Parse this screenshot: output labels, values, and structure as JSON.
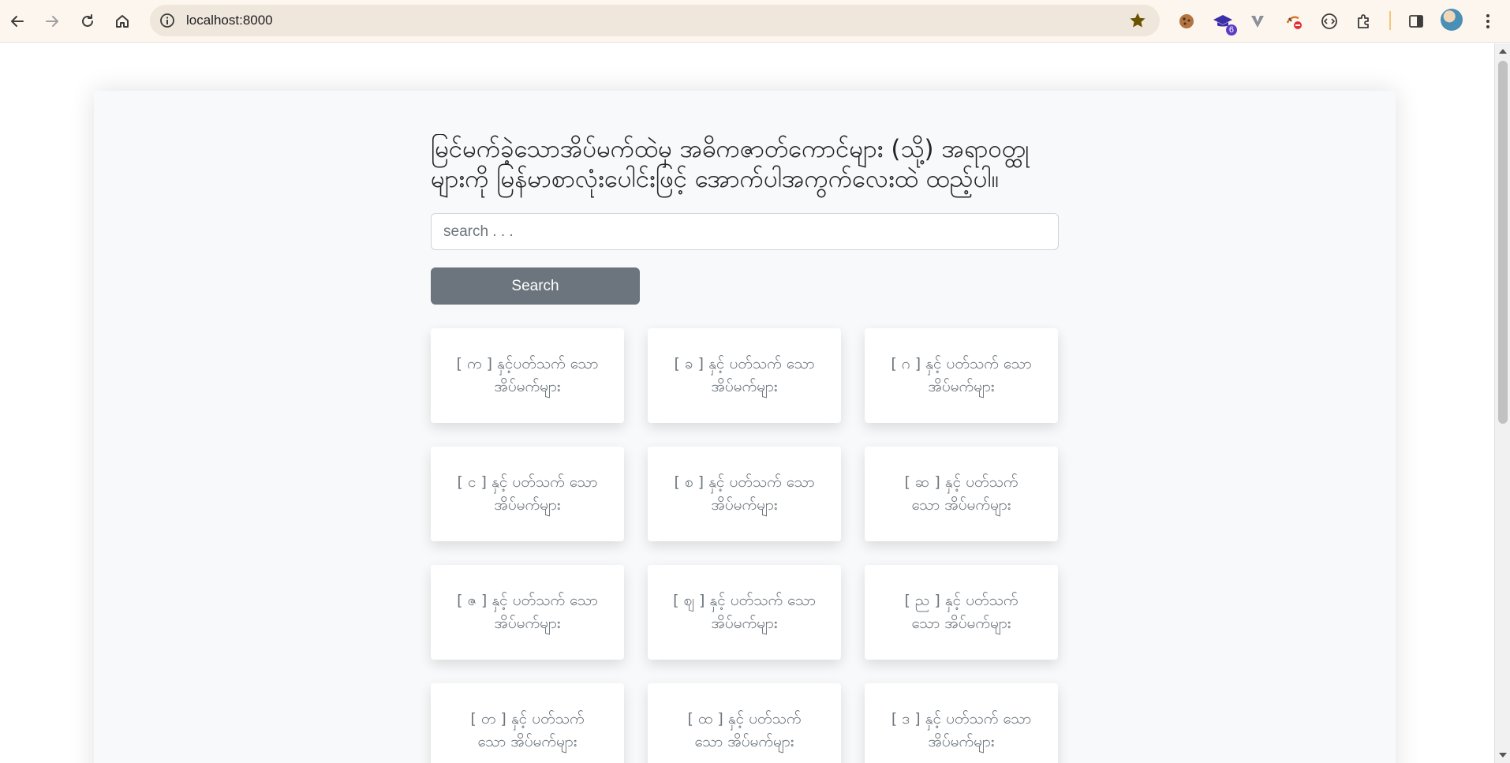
{
  "browser": {
    "url": "localhost:8000",
    "extension_badge": "6"
  },
  "page": {
    "heading": "မြင်မက်ခဲ့သောအိပ်မက်ထဲမှ အဓိကဇာတ်ကောင်များ (သို့) အရာဝတ္ထုများကို မြန်မာစာလုံးပေါင်းဖြင့် အောက်ပါအကွက်လေးထဲ ထည့်ပါ။",
    "search": {
      "placeholder": "search . . .",
      "value": "",
      "button_label": "Search"
    },
    "tiles": [
      "[ က ] နှင့်ပတ်သက် သော အိပ်မက်များ",
      "[ ခ ] နှင့် ပတ်သက် သော အိပ်မက်များ",
      "[ ဂ ] နှင့် ပတ်သက် သော အိပ်မက်များ",
      "[ င ] နှင့် ပတ်သက် သော အိပ်မက်များ",
      "[ စ ] နှင့် ပတ်သက် သော အိပ်မက်များ",
      "[ ဆ ] နှင့် ပတ်သက် သော အိပ်မက်များ",
      "[ ဇ ] နှင့် ပတ်သက် သော အိပ်မက်များ",
      "[ ဈ ] နှင့် ပတ်သက် သော အိပ်မက်များ",
      "[ ည ] နှင့် ပတ်သက် သော အိပ်မက်များ",
      "[ တ ] နှင့် ပတ်သက် သော အိပ်မက်များ",
      "[ ထ ] နှင့် ပတ်သက် သော အိပ်မက်များ",
      "[ ဒ ] နှင့် ပတ်သက် သော အိပ်မက်များ"
    ]
  },
  "colors": {
    "button_bg": "#6c757d",
    "tile_text": "#6c757d",
    "panel_bg": "#f8f9fa",
    "chrome_bg": "#fdf6ee"
  }
}
